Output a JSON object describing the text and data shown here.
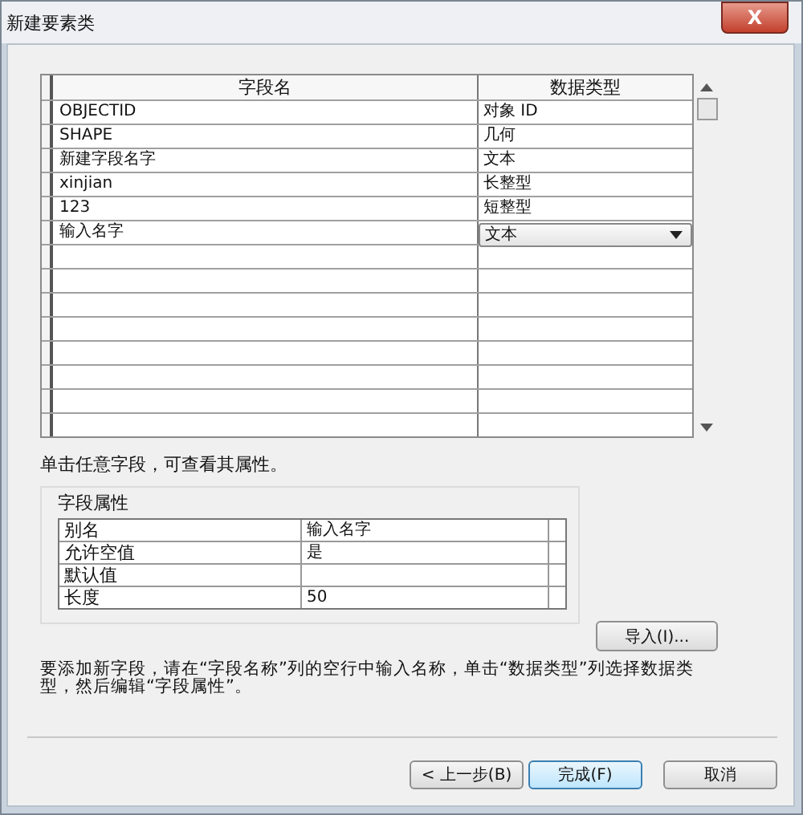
{
  "window": {
    "title": "新建要素类",
    "close_label": "X"
  },
  "fields_table": {
    "columns": [
      "字段名",
      "数据类型"
    ],
    "rows": [
      {
        "name": "OBJECTID",
        "type": "对象 ID",
        "kind": "text"
      },
      {
        "name": "SHAPE",
        "type": "几何",
        "kind": "text"
      },
      {
        "name": "新建字段名字",
        "type": "文本",
        "kind": "text"
      },
      {
        "name": "xinjian",
        "type": "长整型",
        "kind": "text"
      },
      {
        "name": "123",
        "type": "短整型",
        "kind": "text"
      },
      {
        "name": "输入名字",
        "type": "文本",
        "kind": "dropdown"
      }
    ]
  },
  "hint": "单击任意字段，可查看其属性。",
  "field_properties": {
    "title": "字段属性",
    "rows": [
      {
        "property": "别名",
        "value": "输入名字"
      },
      {
        "property": "允许空值",
        "value": "是"
      },
      {
        "property": "默认值",
        "value": ""
      },
      {
        "property": "长度",
        "value": "50"
      }
    ]
  },
  "import_button": "导入(I)...",
  "instructions": "要添加新字段，请在“字段名称”列的空行中输入名称，单击“数据类型”列选择数据类型，然后编辑“字段属性”。",
  "buttons": [
    {
      "label": "< 上一步(B)",
      "default": false
    },
    {
      "label": "完成(F)",
      "default": true
    },
    {
      "label": "取消",
      "default": false
    }
  ]
}
